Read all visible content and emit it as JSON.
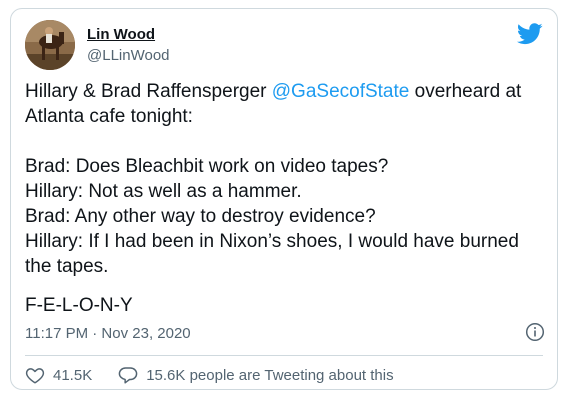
{
  "author": {
    "display_name": "Lin Wood",
    "handle": "@LLinWood"
  },
  "icons": {
    "brand": "twitter-bird-icon",
    "info": "info-icon",
    "like": "heart-icon",
    "reply": "comment-icon"
  },
  "tweet": {
    "line1_prefix": "Hillary & Brad Raffensperger ",
    "mention": "@GaSecofState",
    "line1_suffix": " overheard at Atlanta cafe tonight:",
    "dialogue": [
      "Brad: Does Bleachbit work on video tapes?",
      "Hillary: Not as well as a hammer.",
      "Brad: Any other way to destroy evidence?",
      "Hillary: If I had been in Nixon’s shoes, I would have burned the tapes."
    ],
    "closing": "F-E-L-O-N-Y"
  },
  "meta": {
    "timestamp": "11:17 PM · Nov 23, 2020"
  },
  "actions": {
    "likes": "41.5K",
    "conversation": "15.6K people are Tweeting about this"
  },
  "colors": {
    "accent": "#1d9bf0",
    "text": "#0f1419",
    "muted": "#536471",
    "border": "#cfd9de"
  }
}
